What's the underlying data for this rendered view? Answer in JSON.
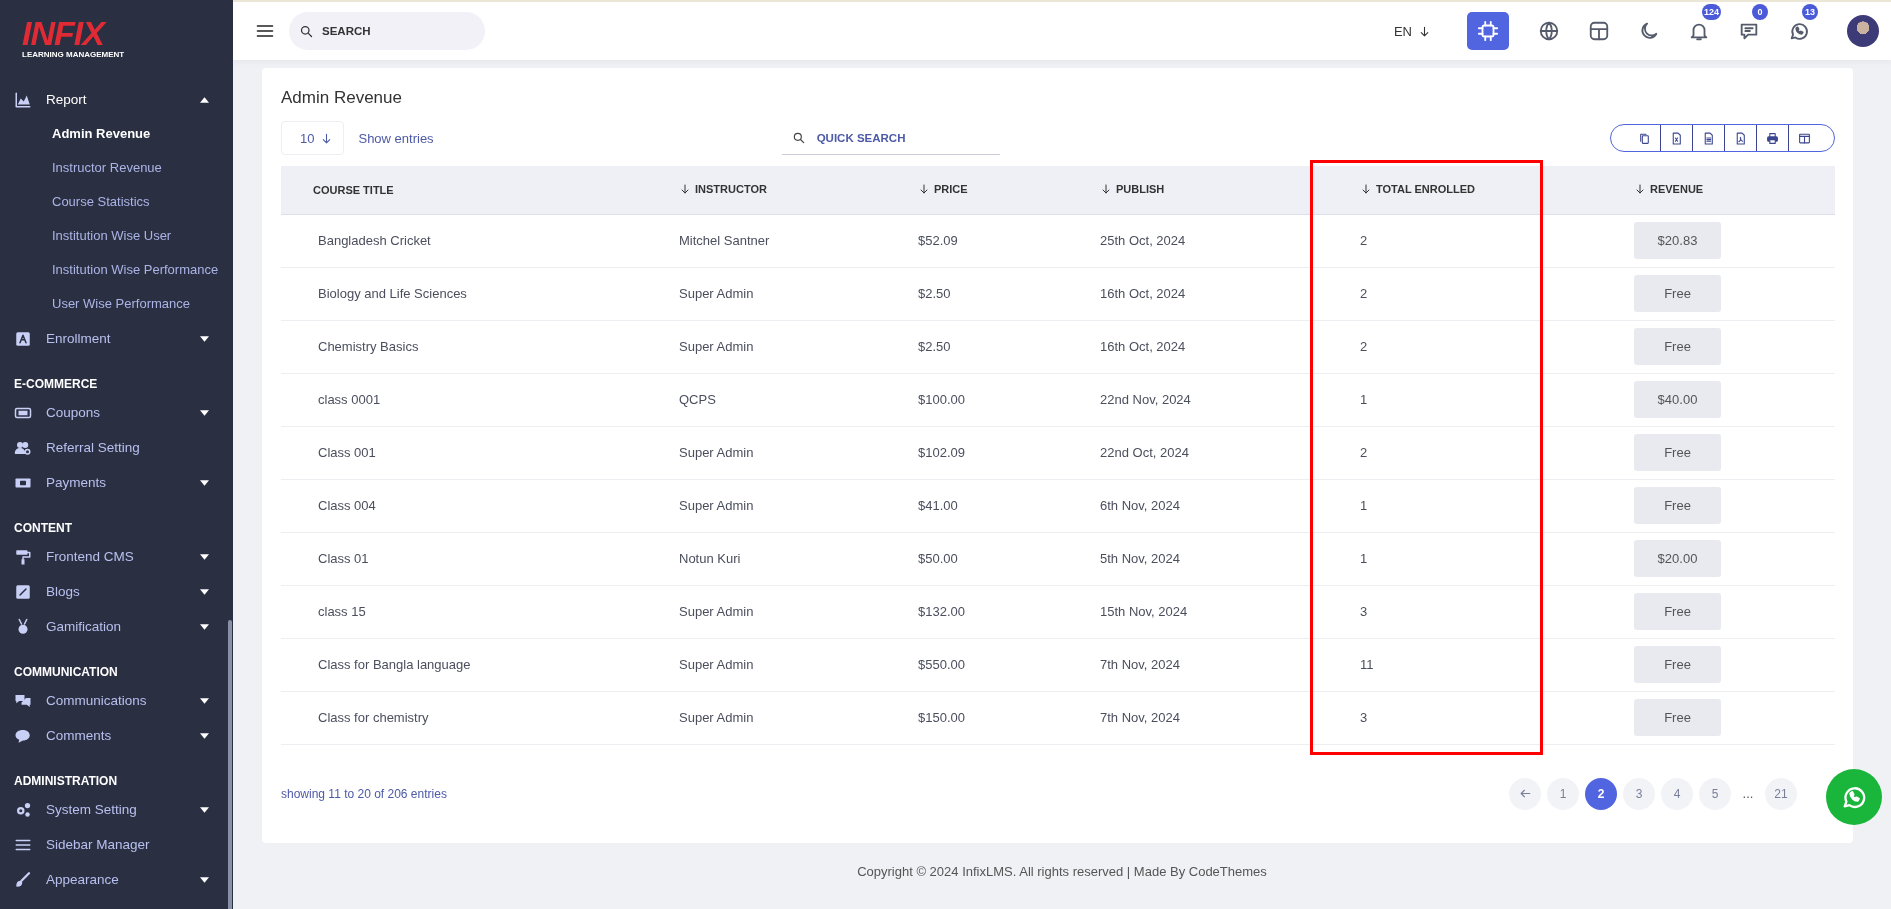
{
  "logo": {
    "name": "INFIX",
    "tagline": "LEARNING MANAGEMENT"
  },
  "sidebar": [
    {
      "kind": "item",
      "label": "Report",
      "expandable": true,
      "expanded": true,
      "children": [
        {
          "label": "Admin Revenue",
          "selected": true
        },
        {
          "label": "Instructor Revenue",
          "selected": false
        },
        {
          "label": "Course Statistics",
          "selected": false
        },
        {
          "label": "Institution Wise User",
          "selected": false
        },
        {
          "label": "Institution Wise Performance",
          "selected": false
        },
        {
          "label": "User Wise Performance",
          "selected": false
        }
      ]
    },
    {
      "kind": "item",
      "label": "Enrollment",
      "expandable": true,
      "expanded": false
    },
    {
      "kind": "heading",
      "label": "E-COMMERCE"
    },
    {
      "kind": "item",
      "label": "Coupons",
      "expandable": true,
      "expanded": false
    },
    {
      "kind": "item",
      "label": "Referral Setting",
      "expandable": false,
      "expanded": false
    },
    {
      "kind": "item",
      "label": "Payments",
      "expandable": true,
      "expanded": false
    },
    {
      "kind": "heading",
      "label": "CONTENT"
    },
    {
      "kind": "item",
      "label": "Frontend CMS",
      "expandable": true,
      "expanded": false
    },
    {
      "kind": "item",
      "label": "Blogs",
      "expandable": true,
      "expanded": false
    },
    {
      "kind": "item",
      "label": "Gamification",
      "expandable": true,
      "expanded": false
    },
    {
      "kind": "heading",
      "label": "COMMUNICATION"
    },
    {
      "kind": "item",
      "label": "Communications",
      "expandable": true,
      "expanded": false
    },
    {
      "kind": "item",
      "label": "Comments",
      "expandable": true,
      "expanded": false
    },
    {
      "kind": "heading",
      "label": "ADMINISTRATION"
    },
    {
      "kind": "item",
      "label": "System Setting",
      "expandable": true,
      "expanded": false
    },
    {
      "kind": "item",
      "label": "Sidebar Manager",
      "expandable": false,
      "expanded": false
    },
    {
      "kind": "item",
      "label": "Appearance",
      "expandable": true,
      "expanded": false
    }
  ],
  "topbar": {
    "search": {
      "placeholder": "SEARCH"
    },
    "language": "EN",
    "badges": {
      "notifications": "124",
      "messages": "0",
      "whatsapp": "13"
    }
  },
  "page_title": "Admin Revenue",
  "entries": {
    "value": "10",
    "label": "Show entries"
  },
  "quick_search": {
    "placeholder": "QUICK SEARCH"
  },
  "table": {
    "columns": [
      {
        "label": "COURSE TITLE",
        "sortable": false,
        "highlighted": false
      },
      {
        "label": "INSTRUCTOR",
        "sortable": true,
        "highlighted": false
      },
      {
        "label": "PRICE",
        "sortable": true,
        "highlighted": false
      },
      {
        "label": "PUBLISH",
        "sortable": true,
        "highlighted": false
      },
      {
        "label": "TOTAL ENROLLED",
        "sortable": true,
        "highlighted": true
      },
      {
        "label": "REVENUE",
        "sortable": true,
        "highlighted": false
      }
    ],
    "rows": [
      {
        "course_title": "Bangladesh Cricket",
        "instructor": "Mitchel Santner",
        "price": "$52.09",
        "publish": "25th Oct, 2024",
        "total_enrolled": "2",
        "revenue": "$20.83"
      },
      {
        "course_title": "Biology and Life Sciences",
        "instructor": "Super Admin",
        "price": "$2.50",
        "publish": "16th Oct, 2024",
        "total_enrolled": "2",
        "revenue": "Free"
      },
      {
        "course_title": "Chemistry Basics",
        "instructor": "Super Admin",
        "price": "$2.50",
        "publish": "16th Oct, 2024",
        "total_enrolled": "2",
        "revenue": "Free"
      },
      {
        "course_title": "class 0001",
        "instructor": "QCPS",
        "price": "$100.00",
        "publish": "22nd Nov, 2024",
        "total_enrolled": "1",
        "revenue": "$40.00"
      },
      {
        "course_title": "Class 001",
        "instructor": "Super Admin",
        "price": "$102.09",
        "publish": "22nd Oct, 2024",
        "total_enrolled": "2",
        "revenue": "Free"
      },
      {
        "course_title": "Class 004",
        "instructor": "Super Admin",
        "price": "$41.00",
        "publish": "6th Nov, 2024",
        "total_enrolled": "1",
        "revenue": "Free"
      },
      {
        "course_title": "Class 01",
        "instructor": "Notun Kuri",
        "price": "$50.00",
        "publish": "5th Nov, 2024",
        "total_enrolled": "1",
        "revenue": "$20.00"
      },
      {
        "course_title": "class 15",
        "instructor": "Super Admin",
        "price": "$132.00",
        "publish": "15th Nov, 2024",
        "total_enrolled": "3",
        "revenue": "Free"
      },
      {
        "course_title": "Class for Bangla language",
        "instructor": "Super Admin",
        "price": "$550.00",
        "publish": "7th Nov, 2024",
        "total_enrolled": "11",
        "revenue": "Free"
      },
      {
        "course_title": "Class for chemistry",
        "instructor": "Super Admin",
        "price": "$150.00",
        "publish": "7th Nov, 2024",
        "total_enrolled": "3",
        "revenue": "Free"
      }
    ]
  },
  "table_info": "showing 11 to 20 of 206 entries",
  "pagination": [
    {
      "kind": "page",
      "label": "1",
      "selected": false
    },
    {
      "kind": "page",
      "label": "2",
      "selected": true
    },
    {
      "kind": "page",
      "label": "3",
      "selected": false
    },
    {
      "kind": "page",
      "label": "4",
      "selected": false
    },
    {
      "kind": "page",
      "label": "5",
      "selected": false
    },
    {
      "kind": "ellipsis",
      "label": "..."
    },
    {
      "kind": "page",
      "label": "21",
      "selected": false
    }
  ],
  "copyright": "Copyright © 2024 InfixLMS. All rights reserved | Made By CodeThemes"
}
